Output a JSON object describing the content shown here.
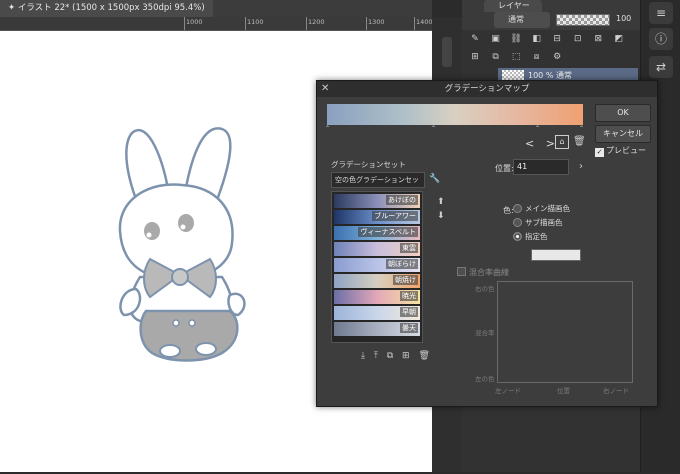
{
  "document": {
    "tab_label": "✦ イラスト 22* (1500 x 1500px 350dpi 95.4%)"
  },
  "ruler": {
    "marks": [
      "1000",
      "1100",
      "1200",
      "1300",
      "1400"
    ]
  },
  "layer_panel": {
    "tab_label": "レイヤー",
    "blend_mode": "通常",
    "opacity": "100",
    "layer_name": "100 % 通常"
  },
  "dialog": {
    "title": "グラデーションマップ",
    "ok_label": "OK",
    "cancel_label": "キャンセル",
    "preview_label": "プレビュー",
    "preview_checked": true,
    "set_section_label": "グラデーションセット",
    "set_selected": "空の色グラデーションセット",
    "gradient_items": [
      {
        "label": "あけぼの"
      },
      {
        "label": "ブルーアワー"
      },
      {
        "label": "ヴィーナスベルト"
      },
      {
        "label": "東雲"
      },
      {
        "label": "朝ぼらけ"
      },
      {
        "label": "朝焼け"
      },
      {
        "label": "暁光"
      },
      {
        "label": "早朝"
      },
      {
        "label": "曇天"
      }
    ],
    "position_label": "位置:",
    "position_value": "41",
    "color_label": "色:",
    "radio_main": "メイン描画色",
    "radio_sub": "サブ描画色",
    "radio_custom": "指定色",
    "curve_label": "混合率曲線",
    "graph_top": "右の色",
    "graph_mid": "混合率",
    "graph_bottom": "左の色",
    "graph_x_left": "左ノード",
    "graph_x_mid": "位置",
    "graph_x_right": "右ノード"
  },
  "colors": {
    "gradient_start": "#8aa0bf",
    "gradient_end": "#f0a072",
    "bunny_outline": "#7d93ad"
  }
}
